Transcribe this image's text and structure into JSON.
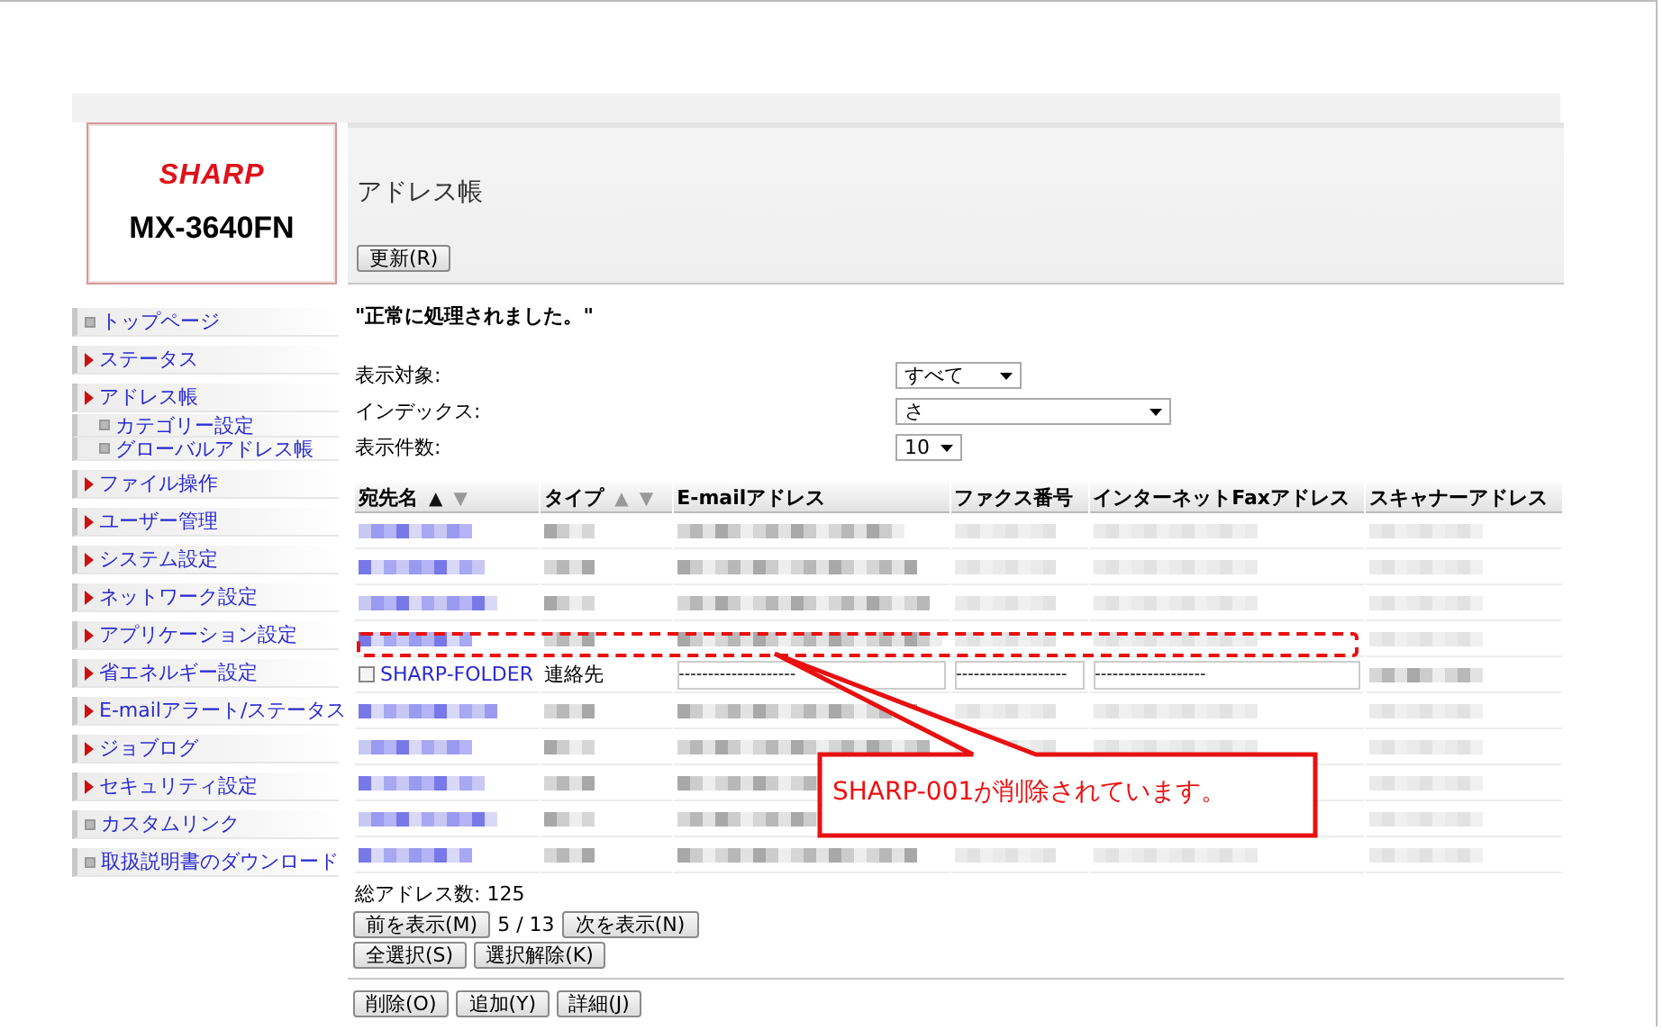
{
  "logo": {
    "brand": "SHARP",
    "model": "MX-3640FN"
  },
  "nav": [
    {
      "label": "トップページ",
      "kind": "page"
    },
    {
      "label": "ステータス",
      "kind": "section"
    },
    {
      "label": "アドレス帳",
      "kind": "section",
      "children": [
        {
          "label": "カテゴリー設定",
          "kind": "page"
        },
        {
          "label": "グローバルアドレス帳",
          "kind": "page"
        }
      ]
    },
    {
      "label": "ファイル操作",
      "kind": "section"
    },
    {
      "label": "ユーザー管理",
      "kind": "section"
    },
    {
      "label": "システム設定",
      "kind": "section"
    },
    {
      "label": "ネットワーク設定",
      "kind": "section"
    },
    {
      "label": "アプリケーション設定",
      "kind": "section"
    },
    {
      "label": "省エネルギー設定",
      "kind": "section"
    },
    {
      "label": "E-mailアラート/ステータス",
      "kind": "section"
    },
    {
      "label": "ジョブログ",
      "kind": "section"
    },
    {
      "label": "セキュリティ設定",
      "kind": "section"
    },
    {
      "label": "カスタムリンク",
      "kind": "page"
    },
    {
      "label": "取扱説明書のダウンロード",
      "kind": "page"
    }
  ],
  "page_title": "アドレス帳",
  "refresh_button": "更新(R)",
  "message": "\"正常に処理されました。\"",
  "filters": [
    {
      "label": "表示対象:",
      "value": "すべて"
    },
    {
      "label": "インデックス:",
      "value": "さ"
    },
    {
      "label": "表示件数:",
      "value": "10"
    }
  ],
  "table": {
    "columns": [
      {
        "label": "宛先名",
        "sort": [
          {
            "glyph": "▲",
            "selected": true
          },
          {
            "glyph": "▼",
            "selected": false
          }
        ]
      },
      {
        "label": "タイプ",
        "sort": [
          {
            "glyph": "▲",
            "selected": false
          },
          {
            "glyph": "▼",
            "selected": false
          }
        ]
      },
      {
        "label": "E-mailアドレス"
      },
      {
        "label": "ファクス番号"
      },
      {
        "label": "インターネットFaxアドレス"
      },
      {
        "label": "スキャナーアドレス"
      }
    ],
    "rows": [
      {
        "kind": "redacted"
      },
      {
        "kind": "redacted"
      },
      {
        "kind": "redacted"
      },
      {
        "kind": "redacted"
      },
      {
        "kind": "entry",
        "checked": false,
        "name": "SHARP-FOLDER",
        "type": "連絡先",
        "email": "--------------------",
        "fax": "-------------------",
        "ifax": "-------------------",
        "scanner": {
          "kind": "redacted"
        }
      },
      {
        "kind": "redacted"
      },
      {
        "kind": "redacted"
      },
      {
        "kind": "redacted_under_callout"
      },
      {
        "kind": "redacted_under_callout"
      },
      {
        "kind": "redacted"
      }
    ]
  },
  "total": {
    "label": "総アドレス数:",
    "value": "125"
  },
  "pager": {
    "prev": "前を表示(M)",
    "page": "5 / 13",
    "next": "次を表示(N)"
  },
  "select_buttons": [
    "全選択(S)",
    "選択解除(K)"
  ],
  "action_buttons": [
    "削除(O)",
    "追加(Y)",
    "詳細(J)"
  ],
  "callout": {
    "text": "SHARP-001が削除されています。"
  }
}
